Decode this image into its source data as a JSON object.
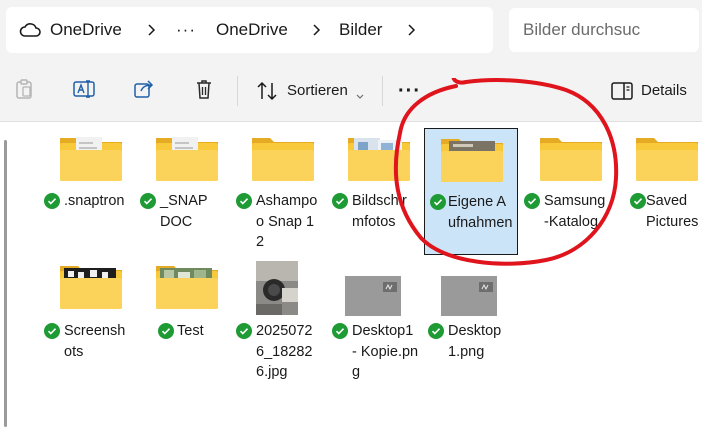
{
  "breadcrumb": {
    "root": "OneDrive",
    "overflow": "···",
    "parent": "OneDrive",
    "current": "Bilder"
  },
  "search": {
    "placeholder": "Bilder durchsuc"
  },
  "toolbar": {
    "sort_label": "Sortieren",
    "more_label": "···",
    "details_label": "Details"
  },
  "files": [
    {
      "name": ".snaptron",
      "type": "folder",
      "sync": "synced"
    },
    {
      "name": "_SNAPDOC",
      "type": "folder",
      "sync": "synced"
    },
    {
      "name": "Ashampoo Snap 12",
      "type": "folder",
      "sync": "synced"
    },
    {
      "name": "Bildschirmfotos",
      "type": "folder",
      "sync": "synced"
    },
    {
      "name": "Eigene Aufnahmen",
      "type": "folder",
      "sync": "synced",
      "selected": true
    },
    {
      "name": "Samsung-Katalog",
      "type": "folder",
      "sync": "synced"
    },
    {
      "name": "Saved Pictures",
      "type": "folder",
      "sync": "synced"
    },
    {
      "name": "Screenshots",
      "type": "folder",
      "sync": "synced"
    },
    {
      "name": "Test",
      "type": "folder",
      "sync": "synced"
    },
    {
      "name": "20250726_182826.jpg",
      "type": "image",
      "sync": "synced"
    },
    {
      "name": "Desktop1 - Kopie.png",
      "type": "image",
      "sync": "synced"
    },
    {
      "name": "Desktop1.png",
      "type": "image",
      "sync": "synced"
    }
  ],
  "colors": {
    "folder": "#f8c93a",
    "selection": "#cce4f7",
    "sync_check": "#1f9b35",
    "annotation": "#e0141c"
  }
}
